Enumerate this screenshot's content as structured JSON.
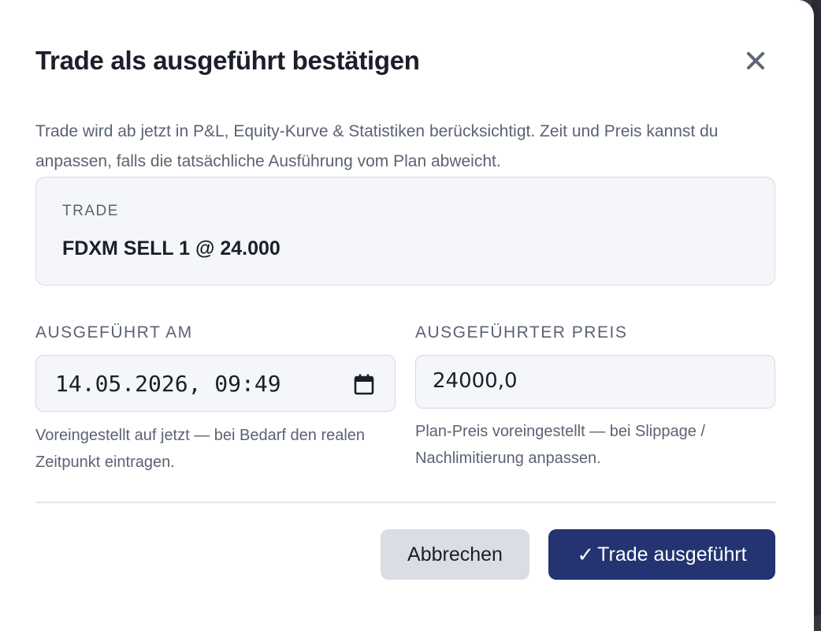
{
  "modal": {
    "title": "Trade als ausgeführt bestätigen",
    "description": "Trade wird ab jetzt in P&L, Equity-Kurve & Statistiken berücksichtigt. Zeit und Preis kannst du anpassen, falls die tatsächliche Ausführung vom Plan abweicht.",
    "close_icon": "close-icon"
  },
  "trade_card": {
    "label": "TRADE",
    "value": "FDXM SELL 1 @ 24.000"
  },
  "executed_at": {
    "label": "AUSGEFÜHRT AM",
    "value": "14.05.2026, 09:49",
    "icon": "calendar-icon",
    "hint": "Voreingestellt auf jetzt — bei Bedarf den realen Zeitpunkt eintragen."
  },
  "executed_price": {
    "label": "AUSGEFÜHRTER PREIS",
    "value": "24000,0",
    "hint": "Plan-Preis voreingestellt — bei Slippage / Nachlimitierung anpassen."
  },
  "buttons": {
    "cancel_label": "Abbrechen",
    "confirm_check": "✓",
    "confirm_label": "Trade ausgeführt"
  },
  "colors": {
    "primary": "#243472",
    "secondary_button": "#d9dde4",
    "text": "#1b1f2a",
    "muted_text": "#5b6372"
  }
}
